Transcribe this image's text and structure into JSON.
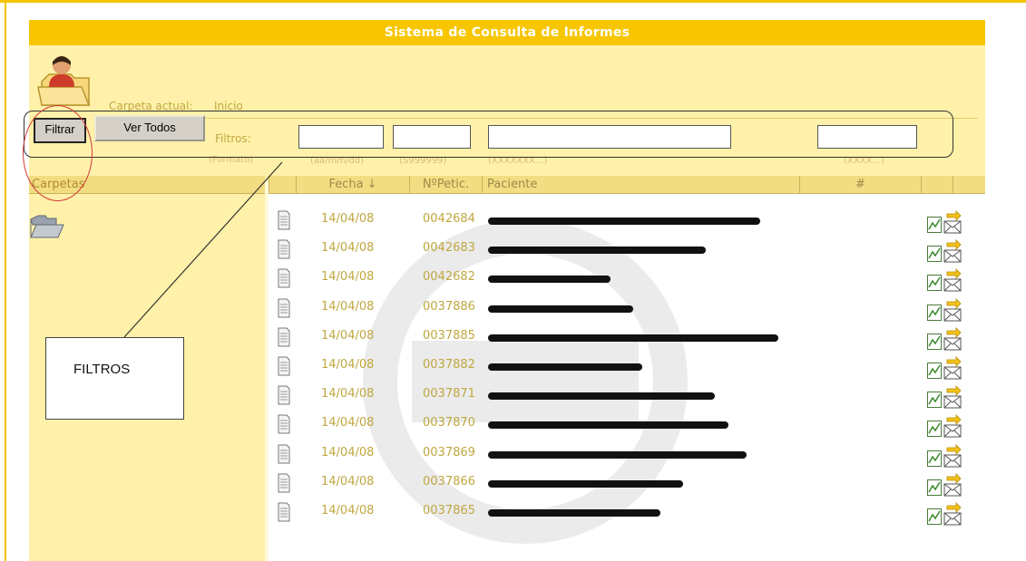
{
  "app": {
    "title": "Sistema de Consulta de Informes"
  },
  "location": {
    "label": "Carpeta actual:",
    "value": "Inicio"
  },
  "toolbar": {
    "filter_label": "Filtrar",
    "show_all_label": "Ver Todos"
  },
  "filters": {
    "label": "Filtros:",
    "format_label": "(Formato)",
    "date_hint": "(aa/mm/dd)",
    "petition_hint": "(S999999)",
    "patient_hint": "(XXXXXXX...)",
    "extra_hint": "(XXXX...)",
    "date_value": "",
    "petition_value": "",
    "patient_value": "",
    "extra_value": ""
  },
  "sidebar": {
    "header": "Carpetas"
  },
  "table": {
    "columns": {
      "fecha": "Fecha ↓",
      "peticion": "NºPetic.",
      "paciente": "Paciente",
      "hash": "#"
    },
    "rows": [
      {
        "fecha": "14/04/08",
        "peticion": "0042684"
      },
      {
        "fecha": "14/04/08",
        "peticion": "0042683"
      },
      {
        "fecha": "14/04/08",
        "peticion": "0042682"
      },
      {
        "fecha": "14/04/08",
        "peticion": "0037886"
      },
      {
        "fecha": "14/04/08",
        "peticion": "0037885"
      },
      {
        "fecha": "14/04/08",
        "peticion": "0037882"
      },
      {
        "fecha": "14/04/08",
        "peticion": "0037871"
      },
      {
        "fecha": "14/04/08",
        "peticion": "0037870"
      },
      {
        "fecha": "14/04/08",
        "peticion": "0037869"
      },
      {
        "fecha": "14/04/08",
        "peticion": "0037866"
      },
      {
        "fecha": "14/04/08",
        "peticion": "0037865"
      }
    ]
  },
  "annotation": {
    "label": "FILTROS"
  },
  "colors": {
    "accent": "#f7c600",
    "panel": "#fff1a9",
    "text_muted": "#c0a740",
    "highlight": "#d23a3a"
  },
  "icons": [
    "user-folder-icon",
    "open-folder-icon",
    "document-icon",
    "chart-icon",
    "mail-send-icon"
  ]
}
